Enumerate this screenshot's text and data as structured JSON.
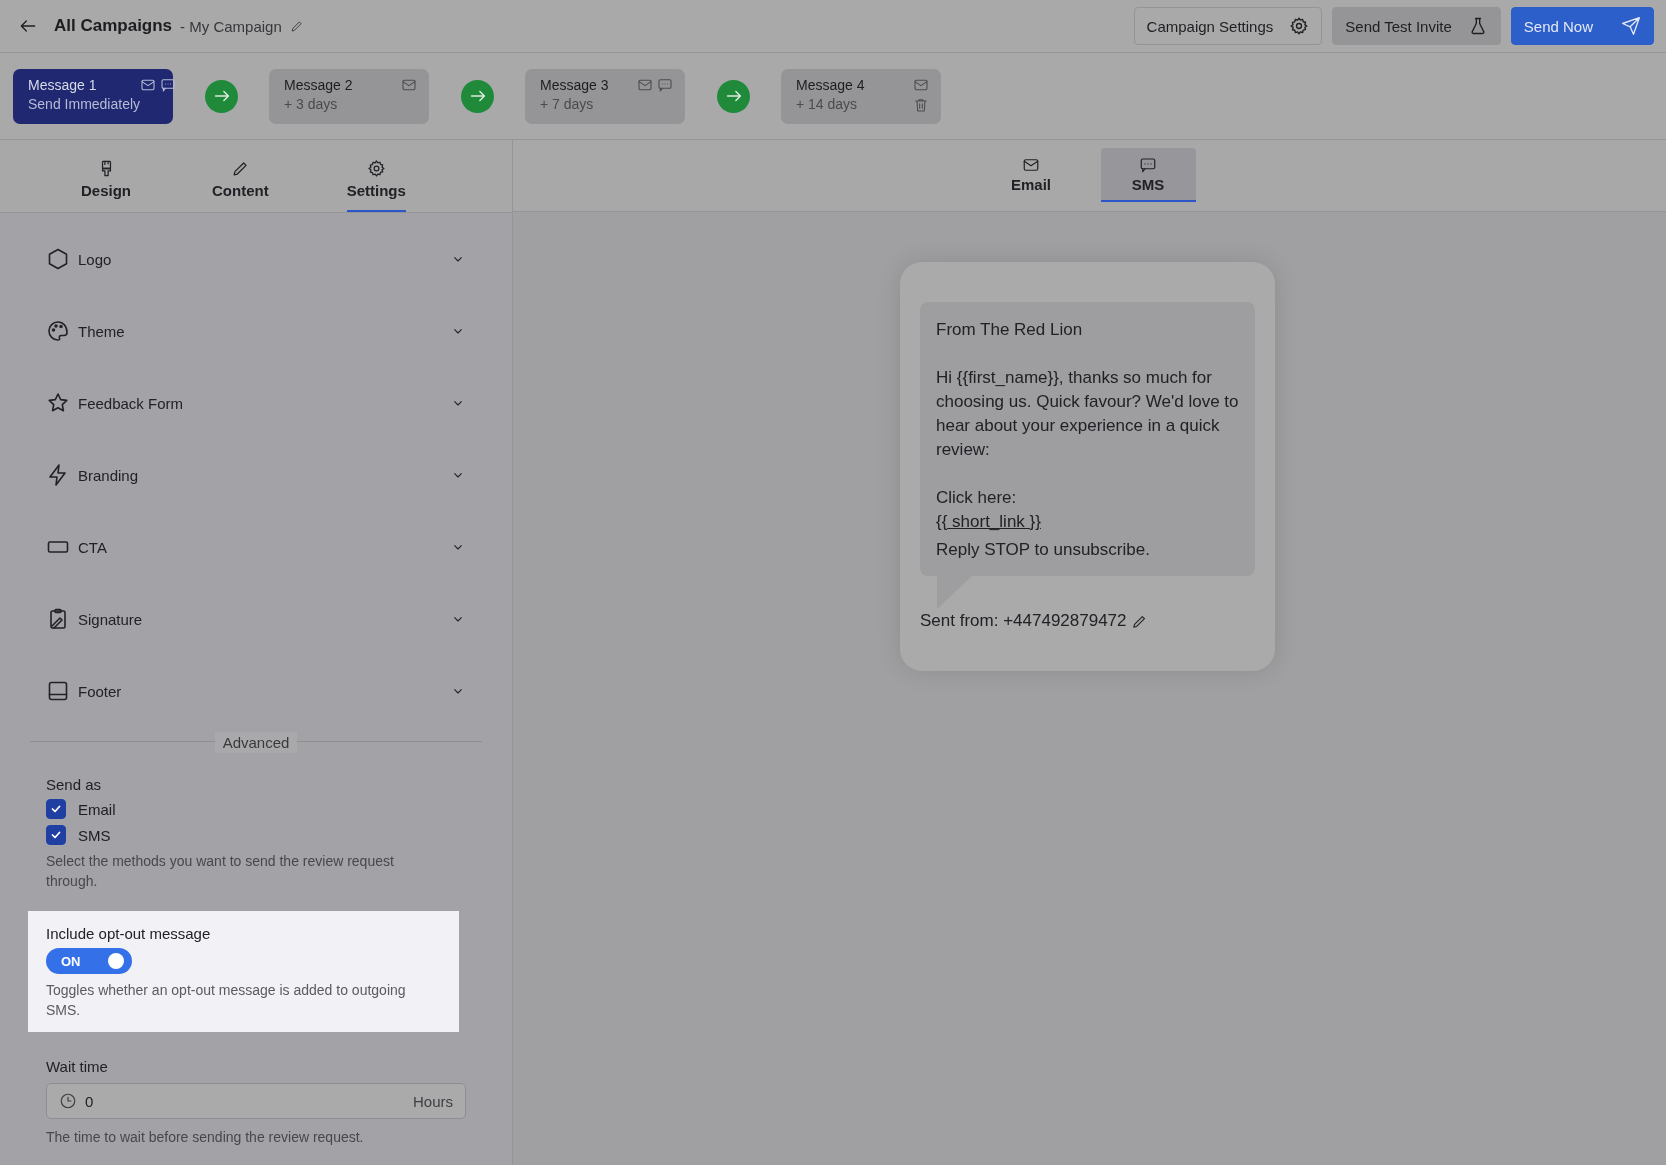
{
  "header": {
    "title": "All Campaigns",
    "subtitle": "- My Campaign",
    "buttons": [
      {
        "kind": "settings",
        "label": "Campaign Settings"
      },
      {
        "kind": "test",
        "label": "Send Test Invite"
      },
      {
        "kind": "primary",
        "label": "Send Now"
      }
    ]
  },
  "steps": [
    {
      "title": "Message 1",
      "subtitle": "Send Immediately",
      "selected": true,
      "email": true,
      "sms": true,
      "deletable": false
    },
    {
      "title": "Message 2",
      "subtitle": "+ 3 days",
      "selected": false,
      "email": true,
      "sms": false,
      "deletable": false
    },
    {
      "title": "Message 3",
      "subtitle": "+ 7 days",
      "selected": false,
      "email": true,
      "sms": true,
      "deletable": false
    },
    {
      "title": "Message 4",
      "subtitle": "+ 14 days",
      "selected": false,
      "email": true,
      "sms": false,
      "deletable": true
    }
  ],
  "editor_tabs": [
    {
      "kind": "design",
      "label": "Design",
      "selected": false
    },
    {
      "kind": "content",
      "label": "Content",
      "selected": false
    },
    {
      "kind": "settings",
      "label": "Settings",
      "selected": true
    }
  ],
  "sections": [
    {
      "kind": "logo",
      "label": "Logo",
      "expanded": false
    },
    {
      "kind": "theme",
      "label": "Theme",
      "expanded": false
    },
    {
      "kind": "form",
      "label": "Feedback Form",
      "expanded": false
    },
    {
      "kind": "branding",
      "label": "Branding",
      "expanded": false
    },
    {
      "kind": "cta",
      "label": "CTA",
      "expanded": false
    },
    {
      "kind": "signature",
      "label": "Signature",
      "expanded": false
    },
    {
      "kind": "footer",
      "label": "Footer",
      "expanded": false
    }
  ],
  "advanced": {
    "divider": "Advanced",
    "send_as": {
      "label": "Send as",
      "options": [
        {
          "label": "Email",
          "checked": true
        },
        {
          "label": "SMS",
          "checked": true
        }
      ],
      "help": "Select the methods you want to send the review request through."
    },
    "opt_out": {
      "label": "Include opt-out message",
      "on": true,
      "toggle_text": "ON",
      "help": "Toggles whether an opt-out message is added to outgoing SMS.",
      "highlighted": true
    },
    "wait_time": {
      "label": "Wait time",
      "value": "0",
      "unit": "Hours",
      "help": "The time to wait before sending the review request."
    }
  },
  "preview_tabs": [
    {
      "kind": "email",
      "label": "Email",
      "selected": false
    },
    {
      "kind": "sms",
      "label": "SMS",
      "selected": true
    }
  ],
  "sms_preview": {
    "lines": [
      {
        "kind": "text",
        "text": "From The Red Lion"
      },
      {
        "kind": "gap"
      },
      {
        "kind": "text",
        "text": "Hi {{first_name}}, thanks so much for choosing us. Quick favour? We'd love to hear about your experience in a quick review:"
      },
      {
        "kind": "gap"
      },
      {
        "kind": "text",
        "text": "Click here:"
      },
      {
        "kind": "link",
        "text": "{{ short_link }}"
      },
      {
        "kind": "text",
        "text": "Reply STOP to unsubscribe."
      }
    ],
    "sent_from": "Sent from: +447492879472"
  }
}
